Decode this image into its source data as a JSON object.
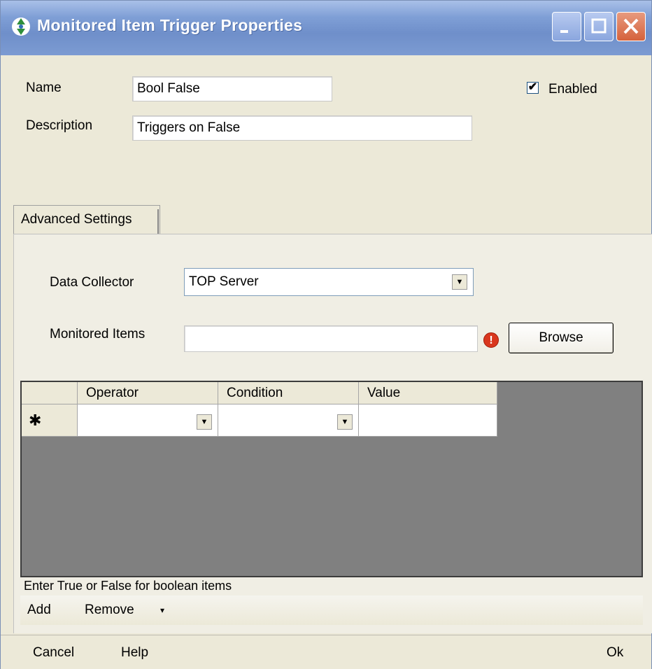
{
  "window": {
    "title": "Monitored Item Trigger Properties"
  },
  "form": {
    "name_label": "Name",
    "name_value": "Bool False",
    "description_label": "Description",
    "description_value": "Triggers on False",
    "enabled_label": "Enabled",
    "enabled_checked": "✔"
  },
  "tab": {
    "label": "Advanced Settings"
  },
  "settings": {
    "data_collector_label": "Data Collector",
    "data_collector_value": "TOP Server",
    "monitored_items_label": "Monitored Items",
    "monitored_items_value": "",
    "warning_glyph": "!",
    "browse_label": "Browse"
  },
  "grid": {
    "columns": [
      "",
      "Operator",
      "Condition",
      "Value"
    ],
    "new_row_marker": "✱",
    "dropdown_glyph": "▼"
  },
  "hint": "Enter True or False for boolean items",
  "toolbar": {
    "add_label": "Add",
    "remove_label": "Remove",
    "remove_arrow": "▾"
  },
  "footer": {
    "cancel_label": "Cancel",
    "help_label": "Help",
    "ok_label": "Ok"
  }
}
